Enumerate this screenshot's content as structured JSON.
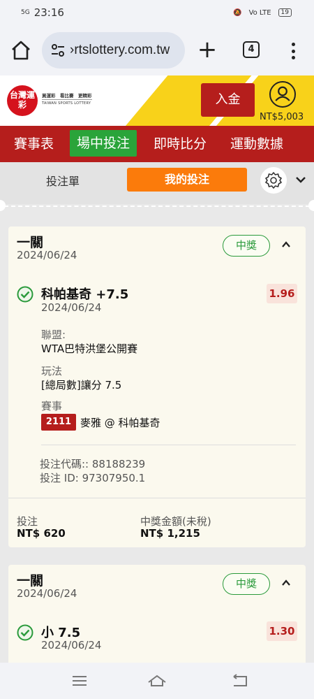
{
  "status_bar": {
    "network": "5G",
    "time": "23:16",
    "battery": "19",
    "signal_label": "Vo LTE"
  },
  "browser": {
    "url": "›rtslottery.com.tw",
    "tab_count": "4"
  },
  "header": {
    "logo_text": "台灣運彩",
    "tagline": "買運彩　看比賽　更精彩",
    "brand_en": "TAIWAN SPORTS LOTTERY",
    "deposit_label": "入金",
    "balance": "NT$5,003"
  },
  "nav": {
    "items": [
      {
        "label": "賽事表"
      },
      {
        "label": "場中投注"
      },
      {
        "label": "即時比分"
      },
      {
        "label": "運動數據"
      }
    ],
    "active_index": 1
  },
  "subtabs": {
    "betslip": "投注單",
    "mybets": "我的投注"
  },
  "cards": [
    {
      "type": "一關",
      "date": "2024/06/24",
      "status": "中獎",
      "selection": "科帕基奇 +7.5",
      "selection_date": "2024/06/24",
      "odds": "1.96",
      "league_label": "聯盟:",
      "league": "WTA巴特洪堡公開賽",
      "market_label": "玩法",
      "market": "[總局數]讓分 7.5",
      "event_label": "賽事",
      "event_number": "2111",
      "event_name": "麥雅 @ 科帕基奇",
      "bet_code": "投注代碼:: 88188239",
      "bet_id": "投注 ID: 97307950.1",
      "stake_label": "投注",
      "stake": "NT$ 620",
      "payout_label": "中獎金額(未稅)",
      "payout": "NT$ 1,215"
    },
    {
      "type": "一關",
      "date": "2024/06/24",
      "status": "中獎",
      "selection": "小 7.5",
      "selection_date": "2024/06/24",
      "odds": "1.30"
    }
  ],
  "colors": {
    "brand_red": "#b51e1c",
    "active_green": "#2aa43a",
    "accent_orange": "#fb7b0b",
    "header_yellow": "#f8d21a",
    "win_green": "#2a9a3b"
  }
}
